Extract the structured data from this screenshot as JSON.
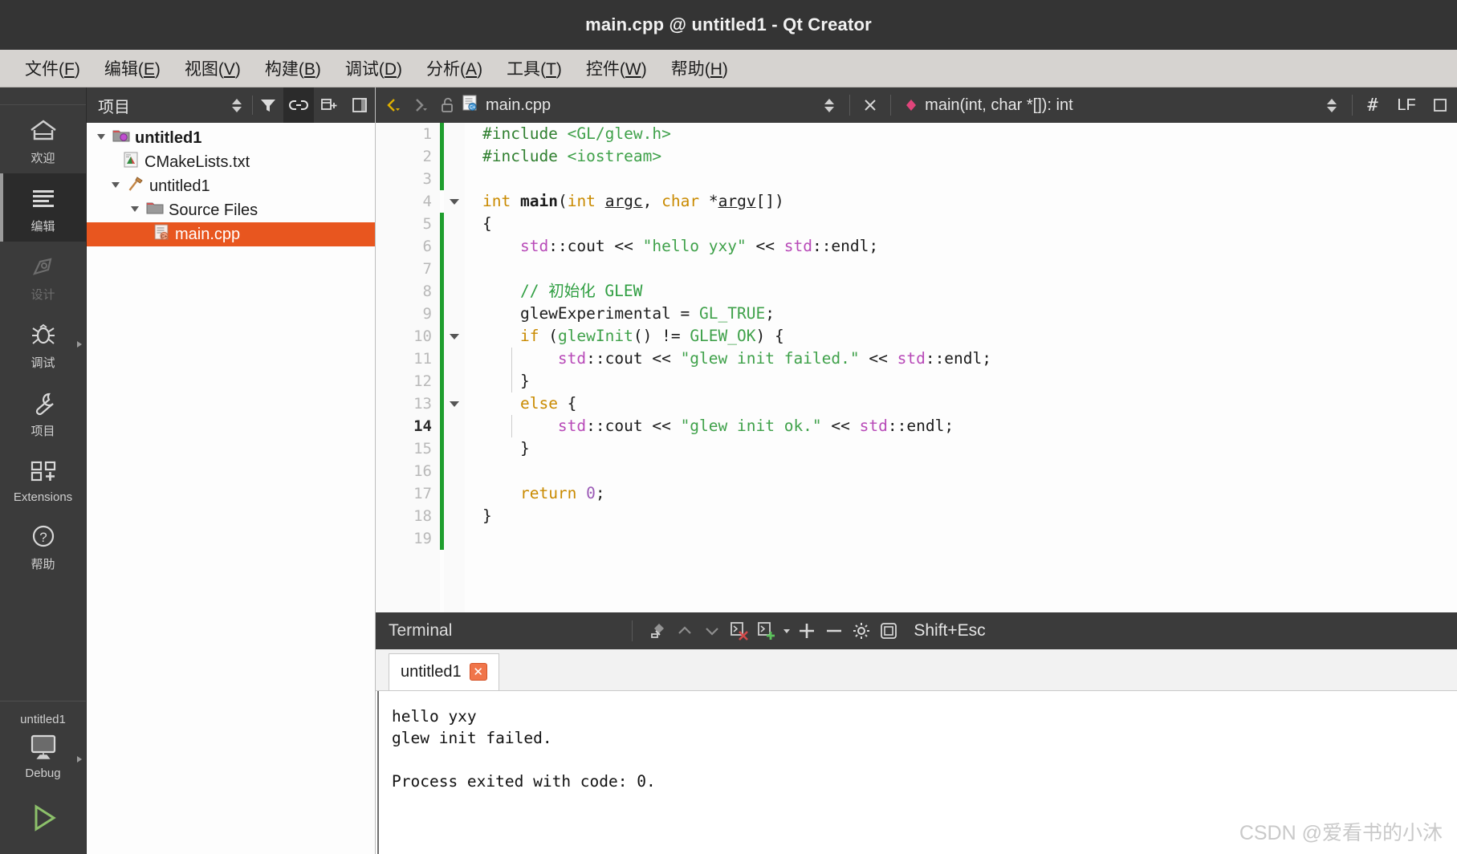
{
  "window": {
    "title": "main.cpp @ untitled1 - Qt Creator"
  },
  "menubar": {
    "items": [
      {
        "text": "文件",
        "mnemonic": "F"
      },
      {
        "text": "编辑",
        "mnemonic": "E"
      },
      {
        "text": "视图",
        "mnemonic": "V"
      },
      {
        "text": "构建",
        "mnemonic": "B"
      },
      {
        "text": "调试",
        "mnemonic": "D"
      },
      {
        "text": "分析",
        "mnemonic": "A"
      },
      {
        "text": "工具",
        "mnemonic": "T"
      },
      {
        "text": "控件",
        "mnemonic": "W"
      },
      {
        "text": "帮助",
        "mnemonic": "H"
      }
    ]
  },
  "modebar": {
    "modes": [
      {
        "label": "欢迎",
        "icon": "home-icon",
        "state": "normal"
      },
      {
        "label": "编辑",
        "icon": "edit-lines-icon",
        "state": "active"
      },
      {
        "label": "设计",
        "icon": "design-pen-icon",
        "state": "disabled"
      },
      {
        "label": "调试",
        "icon": "debug-bug-icon",
        "state": "normal",
        "has_arrow": true
      },
      {
        "label": "项目",
        "icon": "projects-wrench-icon",
        "state": "normal"
      },
      {
        "label": "Extensions",
        "icon": "extensions-blocks-icon",
        "state": "normal"
      },
      {
        "label": "帮助",
        "icon": "help-question-icon",
        "state": "normal"
      }
    ],
    "kit": {
      "project_name": "untitled1",
      "build_config": "Debug",
      "run_icon": "run-play-icon"
    }
  },
  "project_pane": {
    "header": {
      "title": "项目",
      "buttons": [
        "sort-updown-icon",
        "filter-funnel-icon",
        "link-sync-icon",
        "expand-all-icon",
        "hide-sidebar-icon"
      ]
    },
    "tree": [
      {
        "label": "untitled1",
        "icon": "project-folder-icon",
        "depth": 0,
        "expanded": true,
        "bold": true,
        "selected": false
      },
      {
        "label": "CMakeLists.txt",
        "icon": "cmake-file-icon",
        "depth": 1,
        "expanded": null,
        "bold": false,
        "selected": false
      },
      {
        "label": "untitled1",
        "icon": "target-hammer-icon",
        "depth": 1,
        "expanded": true,
        "bold": false,
        "selected": false
      },
      {
        "label": "Source Files",
        "icon": "folder-icon",
        "depth": 2,
        "expanded": true,
        "bold": false,
        "selected": false
      },
      {
        "label": "main.cpp",
        "icon": "cpp-file-icon",
        "depth": 3,
        "expanded": null,
        "bold": false,
        "selected": true
      }
    ]
  },
  "editor_toolbar": {
    "nav_back_icon": "nav-back-icon",
    "nav_forward_icon": "nav-forward-icon",
    "lock_icon": "unlocked-icon",
    "file_icon": "cpp-file-icon",
    "filename": "main.cpp",
    "split_icon": "updown-split-icon",
    "close_icon": "close-x-icon",
    "symbol_icon": "symbol-function-icon",
    "symbol": "main(int, char *[]): int",
    "line_col_icon": "hash-icon",
    "line_ending": "LF",
    "encoding_icon": "encoding-icon"
  },
  "code": {
    "lines": [
      {
        "n": 1,
        "fold": false,
        "current": false
      },
      {
        "n": 2,
        "fold": false,
        "current": false
      },
      {
        "n": 3,
        "fold": false,
        "current": false
      },
      {
        "n": 4,
        "fold": true,
        "current": false
      },
      {
        "n": 5,
        "fold": false,
        "current": false
      },
      {
        "n": 6,
        "fold": false,
        "current": false
      },
      {
        "n": 7,
        "fold": false,
        "current": false
      },
      {
        "n": 8,
        "fold": false,
        "current": false
      },
      {
        "n": 9,
        "fold": false,
        "current": false
      },
      {
        "n": 10,
        "fold": true,
        "current": false
      },
      {
        "n": 11,
        "fold": false,
        "current": false
      },
      {
        "n": 12,
        "fold": false,
        "current": false
      },
      {
        "n": 13,
        "fold": true,
        "current": false
      },
      {
        "n": 14,
        "fold": false,
        "current": true
      },
      {
        "n": 15,
        "fold": false,
        "current": false
      },
      {
        "n": 16,
        "fold": false,
        "current": false
      },
      {
        "n": 17,
        "fold": false,
        "current": false
      },
      {
        "n": 18,
        "fold": false,
        "current": false
      },
      {
        "n": 19,
        "fold": false,
        "current": false
      }
    ],
    "text": [
      "#include <GL/glew.h>",
      "#include <iostream>",
      "",
      "int main(int argc, char *argv[])",
      "{",
      "    std::cout << \"hello yxy\" << std::endl;",
      "",
      "    // 初始化 GLEW",
      "    glewExperimental = GL_TRUE;",
      "    if (glewInit() != GLEW_OK) {",
      "        std::cout << \"glew init failed.\" << std::endl;",
      "    }",
      "    else {",
      "        std::cout << \"glew init ok.\" << std::endl;",
      "    }",
      "",
      "    return 0;",
      "}",
      ""
    ]
  },
  "terminal": {
    "title": "Terminal",
    "toolbar_icons": [
      "clear-broom-icon",
      "prev-up-icon",
      "next-down-icon",
      "stop-close-icon",
      "new-terminal-icon",
      "dropdown-caret-icon",
      "zoom-in-icon",
      "zoom-out-icon",
      "settings-gear-icon",
      "maximize-panel-icon"
    ],
    "shortcut": "Shift+Esc",
    "tabs": [
      {
        "label": "untitled1",
        "close_icon": "close-tab-icon",
        "active": true
      }
    ],
    "output": [
      "hello yxy",
      "glew init failed.",
      "",
      "Process exited with code: 0."
    ]
  },
  "watermark": {
    "text": "CSDN @爱看书的小沐"
  },
  "colors": {
    "accent_orange": "#e8561f",
    "panel_dark": "#3b3b3b",
    "titlebar": "#343434",
    "menubar": "#d6d3d0"
  }
}
